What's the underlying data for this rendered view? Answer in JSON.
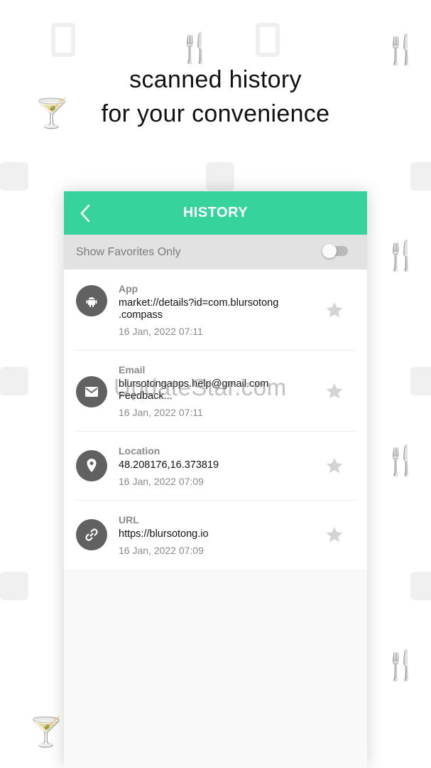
{
  "headline": {
    "line1": "scanned history",
    "line2": "for your convenience"
  },
  "header": {
    "title": "HISTORY",
    "back_icon": "chevron-left-icon"
  },
  "favorites": {
    "label": "Show Favorites Only",
    "enabled": false
  },
  "history": [
    {
      "type": "App",
      "content": "market://details?id=com.blursotong\n.compass",
      "date": "16 Jan, 2022 07:11",
      "icon": "android-icon",
      "favorite": false
    },
    {
      "type": "Email",
      "content": "blursotongapps.help@gmail.com\nFeedback...",
      "date": "16 Jan, 2022 07:11",
      "icon": "email-icon",
      "favorite": false
    },
    {
      "type": "Location",
      "content": "48.208176,16.373819",
      "date": "16 Jan, 2022 07:09",
      "icon": "location-pin-icon",
      "favorite": false
    },
    {
      "type": "URL",
      "content": "https://blursotong.io",
      "date": "16 Jan, 2022 07:09",
      "icon": "link-icon",
      "favorite": false
    }
  ],
  "watermark": "UpdateStar.com",
  "colors": {
    "accent": "#36d39d",
    "icon_bg": "#616161",
    "star": "#d4d4d4"
  }
}
